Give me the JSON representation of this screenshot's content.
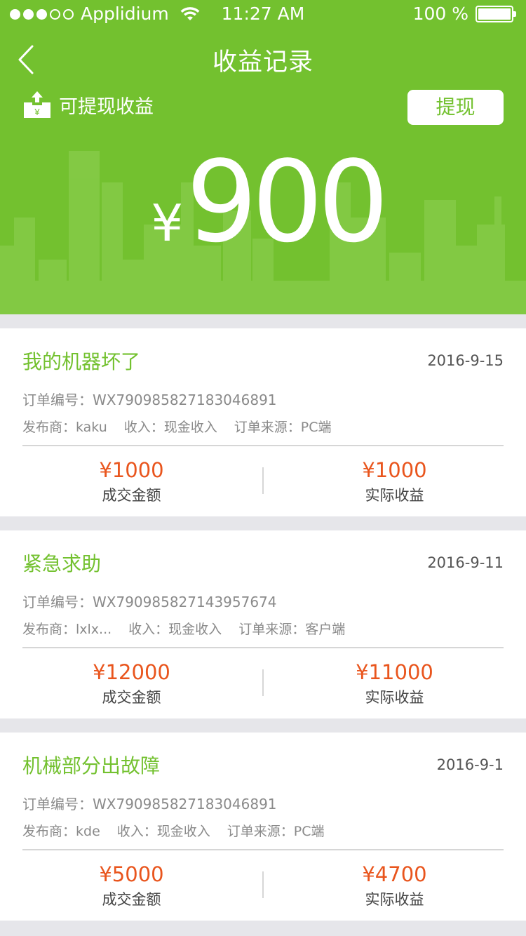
{
  "status": {
    "carrier": "Applidium",
    "time": "11:27 AM",
    "battery": "100 %",
    "signal_bars_filled": 3,
    "signal_bars_total": 5
  },
  "nav": {
    "title": "收益记录",
    "back_icon": "chevron-left-icon"
  },
  "balance": {
    "label": "可提现收益",
    "withdraw_button": "提现",
    "currency": "¥",
    "amount": "900"
  },
  "colors": {
    "primary": "#73c12f",
    "amount_red": "#e9551d",
    "background": "#e6e6ea"
  },
  "records": [
    {
      "title": "我的机器坏了",
      "date": "2016-9-15",
      "order_no": "订单编号：WX790985827183046891",
      "publisher": "发布商：kaku",
      "income": "收入：现金收入",
      "source": "订单来源：PC端",
      "deal_amount": "¥1000",
      "deal_label": "成交金额",
      "actual_amount": "¥1000",
      "actual_label": "实际收益"
    },
    {
      "title": "紧急求助",
      "date": "2016-9-11",
      "order_no": "订单编号：WX790985827143957674",
      "publisher": "发布商：lxlx...",
      "income": "收入：现金收入",
      "source": "订单来源：客户端",
      "deal_amount": "¥12000",
      "deal_label": "成交金额",
      "actual_amount": "¥11000",
      "actual_label": "实际收益"
    },
    {
      "title": "机械部分出故障",
      "date": "2016-9-1",
      "order_no": "订单编号：WX790985827183046891",
      "publisher": "发布商：kde",
      "income": "收入：现金收入",
      "source": "订单来源：PC端",
      "deal_amount": "¥5000",
      "deal_label": "成交金额",
      "actual_amount": "¥4700",
      "actual_label": "实际收益"
    }
  ]
}
